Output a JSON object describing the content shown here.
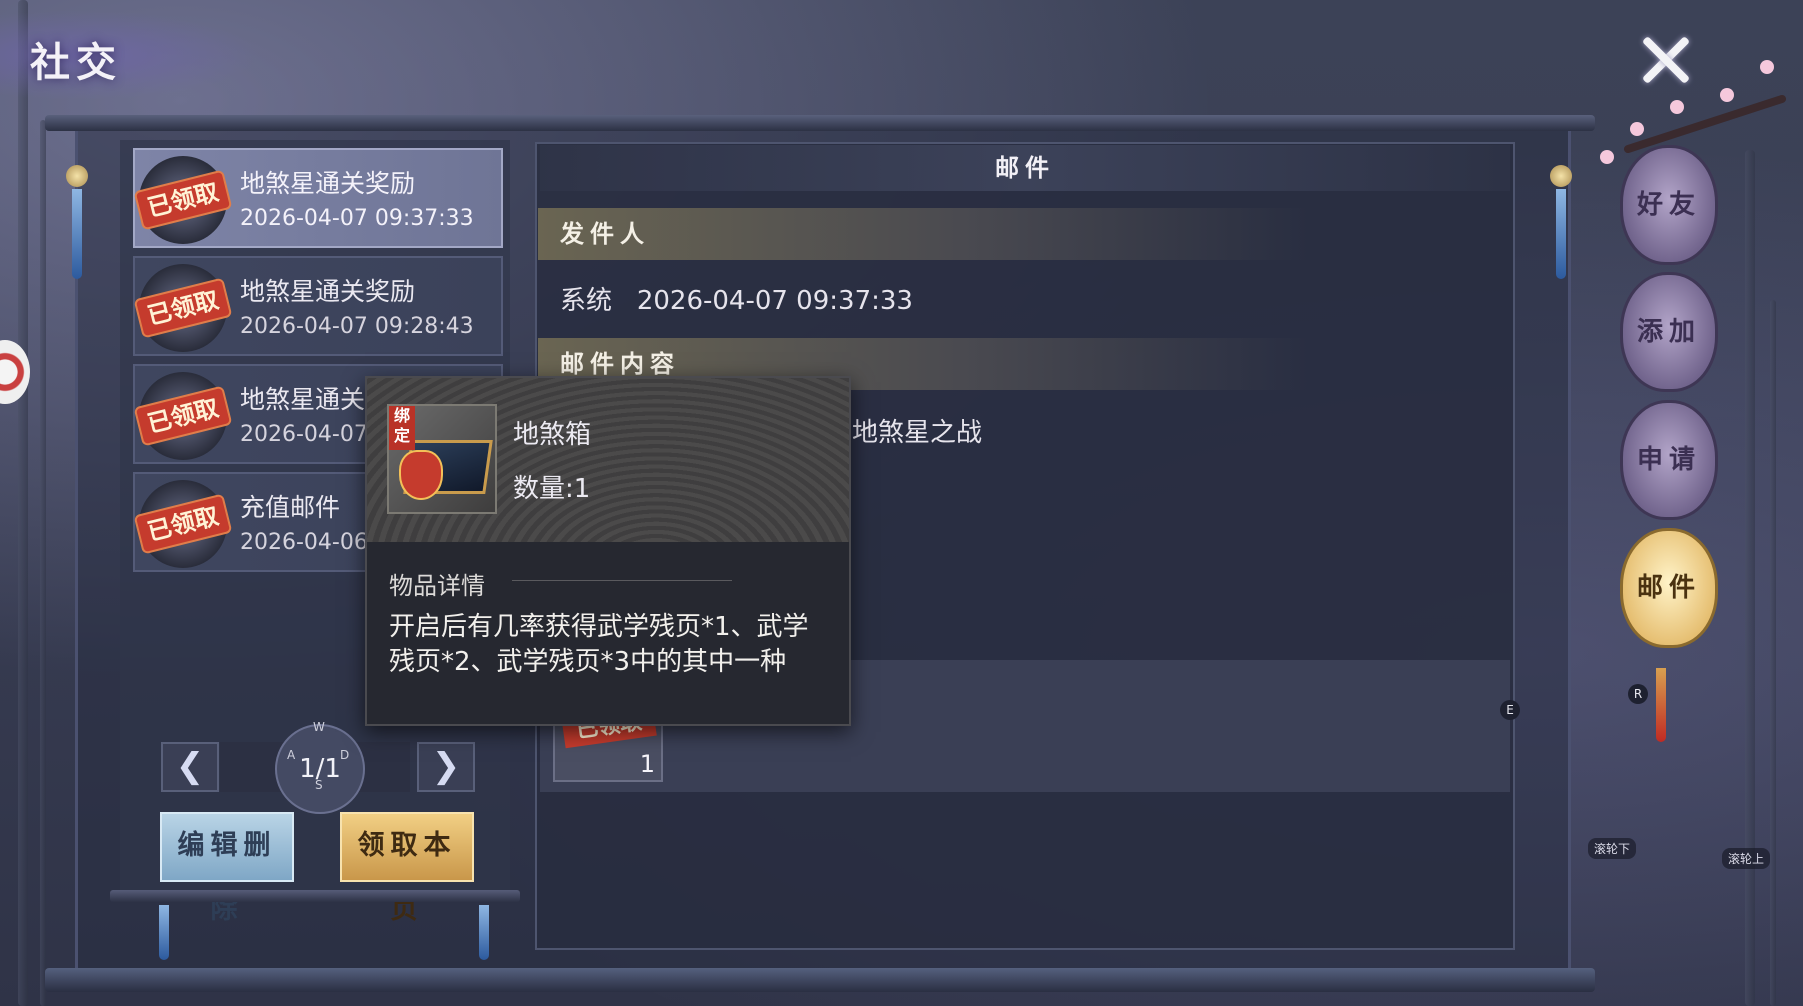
{
  "window": {
    "title": "社交"
  },
  "colors": {
    "accent_gold": "#e3b968",
    "stamp_red": "#c53b2d",
    "panel": "#282d40"
  },
  "icons": {
    "close": "close-icon",
    "prev": "chevron-left-icon",
    "next": "chevron-right-icon"
  },
  "mail_list": [
    {
      "status": "已领取",
      "title": "地煞星通关奖励",
      "time": "2026-04-07 09:37:33",
      "selected": true
    },
    {
      "status": "已领取",
      "title": "地煞星通关奖励",
      "time": "2026-04-07 09:28:43",
      "selected": false
    },
    {
      "status": "已领取",
      "title": "地煞星通关",
      "time": "2026-04-07",
      "selected": false
    },
    {
      "status": "已领取",
      "title": "充值邮件",
      "time": "2026-04-06",
      "selected": false
    }
  ],
  "pager": {
    "page": "1/1",
    "keys": {
      "up": "W",
      "left": "A",
      "right": "D",
      "down": "S"
    }
  },
  "buttons": {
    "edit_delete": "编辑删除",
    "claim_page": "领取本页"
  },
  "mail_detail": {
    "header": "邮件",
    "sender_label": "发件人",
    "sender_name": "系统",
    "sent_time": "2026-04-07 09:37:33",
    "content_label": "邮件内容",
    "content_text": "地煞星之战",
    "attachment": {
      "status": "已领取",
      "count": "1"
    },
    "hotkey": "E"
  },
  "tooltip": {
    "bind_label": "绑定",
    "item_name": "地煞箱",
    "quantity": "数量:1",
    "detail_label": "物品详情",
    "description": "开启后有几率获得武学残页*1、武学残页*2、武学残页*3中的其中一种"
  },
  "tabs": [
    {
      "label": "好友",
      "active": false
    },
    {
      "label": "添加",
      "active": false
    },
    {
      "label": "申请",
      "active": false
    },
    {
      "label": "邮件",
      "active": true
    }
  ],
  "hints": {
    "r_key": "R",
    "scroll_down": "滚轮下",
    "scroll_up": "滚轮上"
  }
}
